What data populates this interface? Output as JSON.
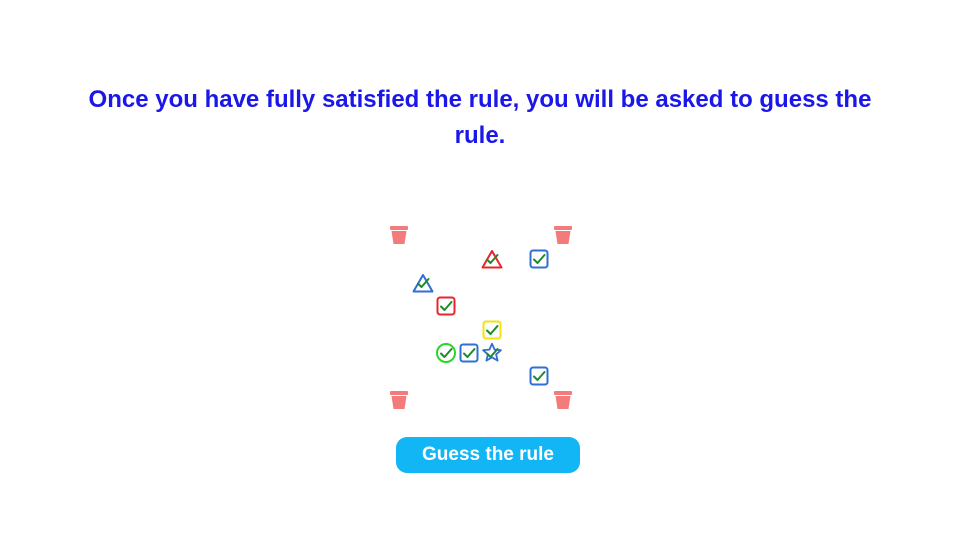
{
  "instruction": {
    "text": "Once you have fully satisfied the rule, you will be asked to guess the rule.",
    "color": "#1a17e8"
  },
  "board": {
    "buckets": [
      {
        "corner": "top-left",
        "icon": "bucket-icon",
        "color": "#f47b7b"
      },
      {
        "corner": "top-right",
        "icon": "bucket-icon",
        "color": "#f47b7b"
      },
      {
        "corner": "bottom-left",
        "icon": "bucket-icon",
        "color": "#f47b7b"
      },
      {
        "corner": "bottom-right",
        "icon": "bucket-icon",
        "color": "#f47b7b"
      }
    ],
    "pieces": [
      {
        "shape": "triangle",
        "color": "red",
        "checked": true
      },
      {
        "shape": "square",
        "color": "blue",
        "checked": true
      },
      {
        "shape": "triangle",
        "color": "blue",
        "checked": true
      },
      {
        "shape": "square",
        "color": "red",
        "checked": true
      },
      {
        "shape": "square",
        "color": "yellow",
        "checked": true
      },
      {
        "shape": "circle",
        "color": "green",
        "checked": true
      },
      {
        "shape": "square",
        "color": "blue",
        "checked": true
      },
      {
        "shape": "star",
        "color": "blue",
        "checked": true
      },
      {
        "shape": "square",
        "color": "blue",
        "checked": true
      }
    ],
    "colors": {
      "red": "#e8262d",
      "blue": "#2f6fd6",
      "yellow": "#f2e30c",
      "green": "#2ad62a",
      "check": "#1f8a2b"
    }
  },
  "guess_button": {
    "label": "Guess the rule",
    "color": "#12b6f5"
  }
}
